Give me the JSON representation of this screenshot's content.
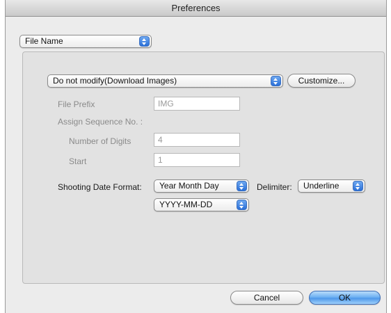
{
  "window": {
    "title": "Preferences"
  },
  "category_popup": {
    "value": "File Name"
  },
  "rename_popup": {
    "value": "Do not modify(Download Images)"
  },
  "customize_button": {
    "label": "Customize..."
  },
  "file_prefix": {
    "label": "File Prefix",
    "value": "IMG"
  },
  "sequence": {
    "label": "Assign Sequence No. :",
    "digits_label": "Number of Digits",
    "digits_value": "4",
    "start_label": "Start",
    "start_value": "1"
  },
  "shooting_date": {
    "label": "Shooting Date Format:",
    "format_value": "Year Month Day",
    "pattern_value": "YYYY-MM-DD"
  },
  "delimiter": {
    "label": "Delimiter:",
    "value": "Underline"
  },
  "footer": {
    "cancel_label": "Cancel",
    "ok_label": "OK"
  },
  "colors": {
    "window_bg": "#ececec",
    "group_bg": "#e2e2e2",
    "accent_blue": "#4f98ea",
    "disabled_text": "#8a8a8a"
  }
}
